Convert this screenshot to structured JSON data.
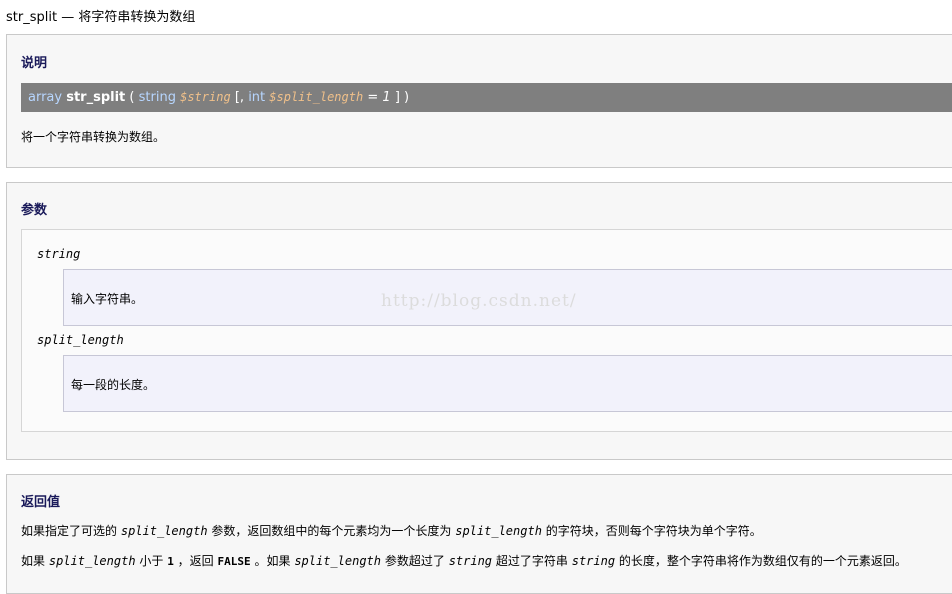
{
  "header": {
    "title": "str_split — 将字符串转换为数组"
  },
  "description": {
    "heading": "说明",
    "signature": {
      "return_type": "array",
      "name": "str_split",
      "open": "(",
      "p1_type": "string",
      "p1_name": "$string",
      "opt_open": "[,",
      "p2_type": "int",
      "p2_name": "$split_length",
      "eq": "=",
      "default": "1",
      "close": "] )"
    },
    "text": "将一个字符串转换为数组。"
  },
  "parameters": {
    "heading": "参数",
    "items": [
      {
        "name": "string",
        "desc": "输入字符串。"
      },
      {
        "name": "split_length",
        "desc": "每一段的长度。"
      }
    ]
  },
  "return_values": {
    "heading": "返回值",
    "line1": {
      "a": "如果指定了可选的",
      "code1": "split_length",
      "b": "参数，返回数组中的每个元素均为一个长度为",
      "code2": "split_length",
      "c": "的字符块，否则每个字符块为单个字符。"
    },
    "line2": {
      "a": "如果",
      "code1": "split_length",
      "b": "小于",
      "num": "1",
      "c": "，返回",
      "const": "FALSE",
      "d": "。如果",
      "code2": "split_length",
      "e": "参数超过了",
      "code3": "string",
      "f": "超过了字符串",
      "code4": "string",
      "g": "的长度，整个字符串将作为数组仅有的一个元素返回。"
    }
  },
  "watermark": "http://blog.csdn.net/"
}
